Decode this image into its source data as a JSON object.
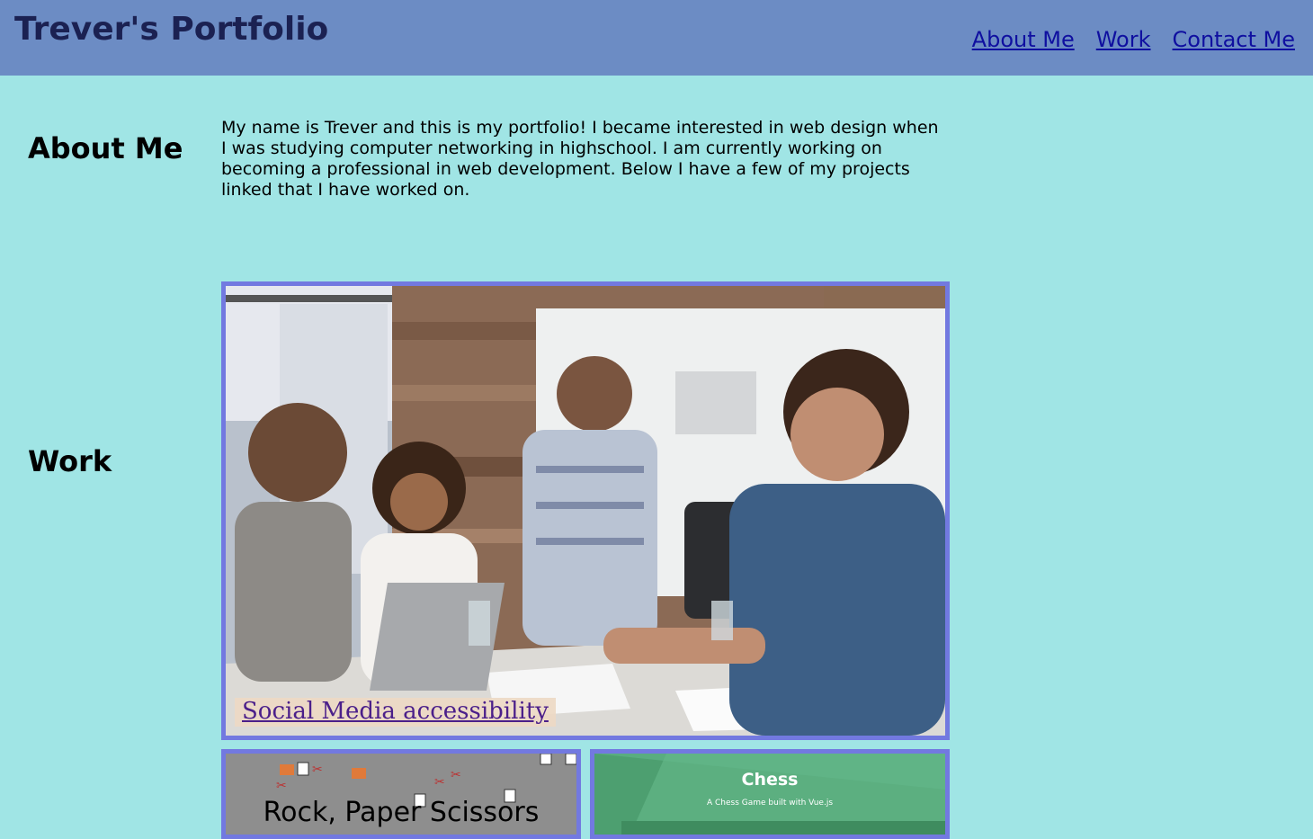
{
  "site": {
    "title": "Trever's Portfolio"
  },
  "nav": {
    "items": [
      {
        "label": "About Me"
      },
      {
        "label": "Work"
      },
      {
        "label": "Contact Me"
      }
    ]
  },
  "about": {
    "heading": "About Me",
    "text": "My name is Trever and this is my portfolio! I became interested in web design when I was studying computer networking in highschool. I am currently working on becoming a professional in web development. Below I have a few of my projects linked that I have worked on."
  },
  "work": {
    "heading": "Work",
    "projects": [
      {
        "link_text": "Social Media accessibility"
      },
      {
        "title": "Rock, Paper Scissors"
      },
      {
        "title": "Chess",
        "subtitle": "A Chess Game built with Vue.js"
      }
    ]
  },
  "colors": {
    "page_bg": "#a0e5e5",
    "header_bg": "#6c8cc4",
    "card_border": "#7279e0",
    "link": "#0f0fa0"
  }
}
